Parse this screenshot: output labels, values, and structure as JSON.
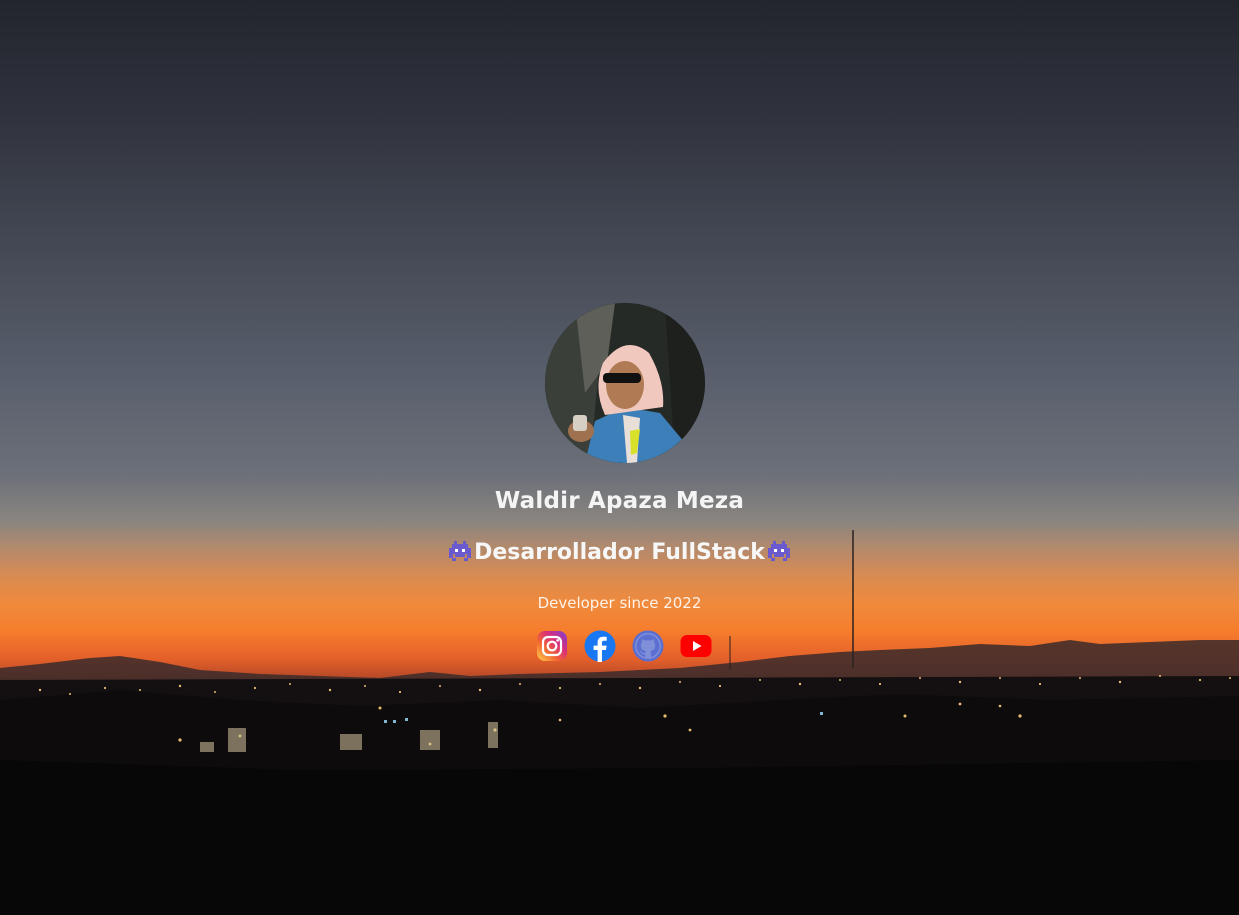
{
  "profile": {
    "name": "Waldir Apaza Meza",
    "role": "Desarrollador FullStack",
    "role_emoji": "alien-monster-icon",
    "tagline": "Developer since 2022"
  },
  "socials": [
    {
      "name": "instagram-icon",
      "label": "Instagram"
    },
    {
      "name": "facebook-icon",
      "label": "Facebook"
    },
    {
      "name": "github-icon",
      "label": "GitHub"
    },
    {
      "name": "youtube-icon",
      "label": "YouTube"
    }
  ],
  "colors": {
    "sunset_orange": "#f57d2c",
    "sky_top": "#23252e",
    "text": "#f4f4f4",
    "facebook": "#1877f2",
    "github": "#5b6ed1",
    "youtube": "#ff0000",
    "emoji": "#6a5acd"
  }
}
